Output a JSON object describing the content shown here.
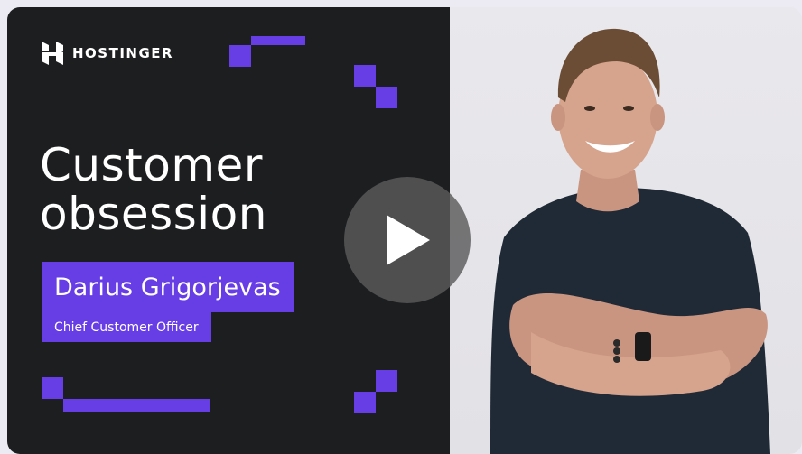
{
  "brand": {
    "name": "HOSTINGER"
  },
  "video": {
    "title_line1": "Customer",
    "title_line2": "obsession",
    "speaker_name": "Darius Grigorjevas",
    "speaker_role": "Chief Customer Officer"
  },
  "colors": {
    "panel_dark": "#1d1e20",
    "accent_purple": "#673de6",
    "photo_background": "#e7e6ea",
    "play_button": "#5a5a5c"
  },
  "icons": {
    "logo": "hostinger-logo-icon",
    "play": "play-icon"
  }
}
